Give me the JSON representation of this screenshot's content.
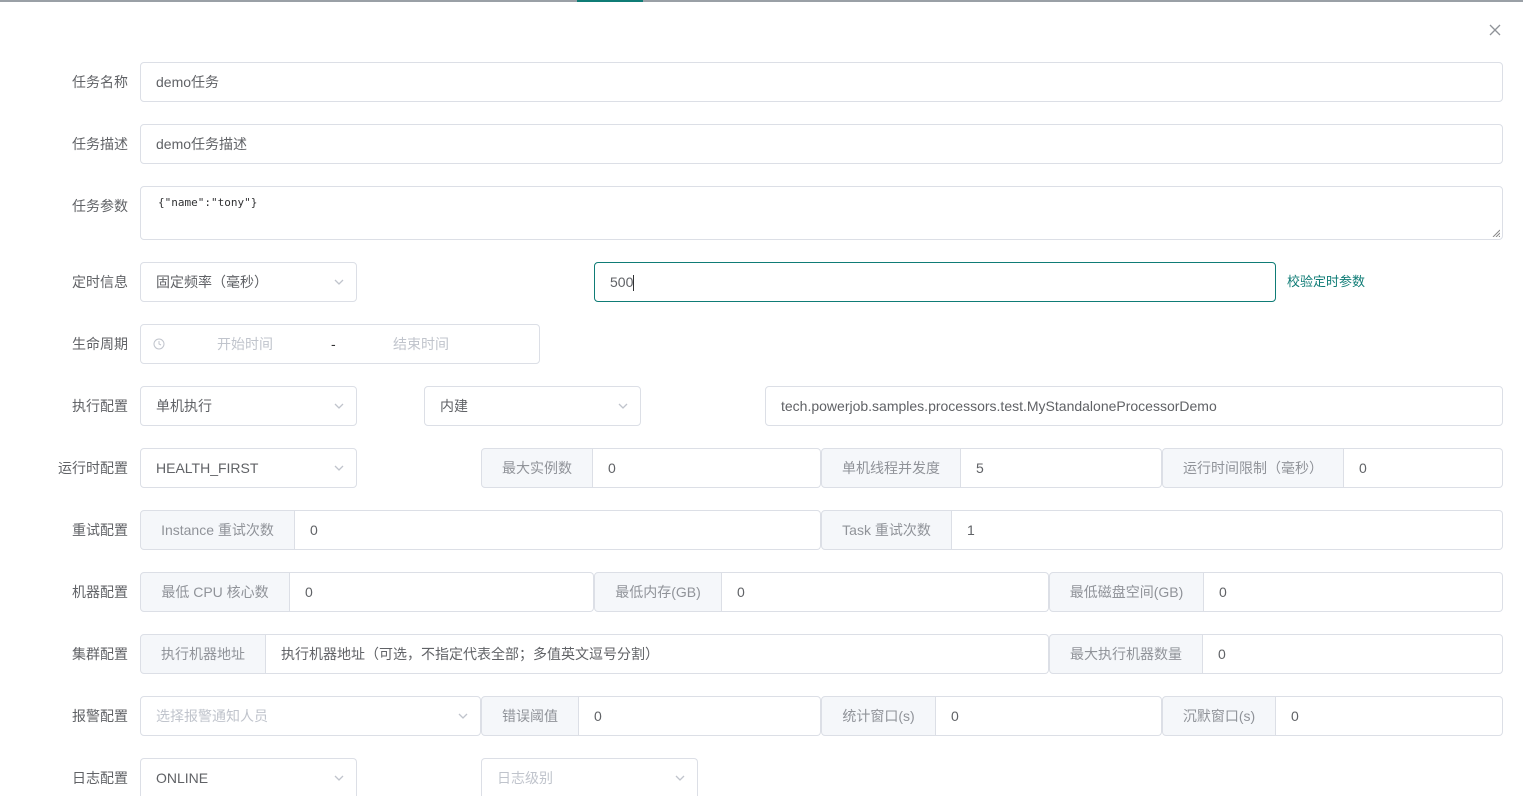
{
  "labels": {
    "task_name": "任务名称",
    "task_desc": "任务描述",
    "task_params": "任务参数",
    "timing": "定时信息",
    "lifecycle": "生命周期",
    "execution": "执行配置",
    "runtime": "运行时配置",
    "retry": "重试配置",
    "machine": "机器配置",
    "cluster": "集群配置",
    "alarm": "报警配置",
    "log": "日志配置"
  },
  "task_name": {
    "value": "demo任务"
  },
  "task_desc": {
    "value": "demo任务描述"
  },
  "task_params": {
    "value": "{\"name\":\"tony\"}"
  },
  "timing": {
    "type": "固定频率（毫秒）",
    "expression": "500",
    "validate_link": "校验定时参数"
  },
  "lifecycle": {
    "start_placeholder": "开始时间",
    "separator": "-",
    "end_placeholder": "结束时间"
  },
  "execution": {
    "mode": "单机执行",
    "processor_type": "内建",
    "processor_info": "tech.powerjob.samples.processors.test.MyStandaloneProcessorDemo"
  },
  "runtime": {
    "dispatch_strategy": "HEALTH_FIRST",
    "max_instances_label": "最大实例数",
    "max_instances": "0",
    "concurrency_label": "单机线程并发度",
    "concurrency": "5",
    "time_limit_label": "运行时间限制（毫秒）",
    "time_limit": "0"
  },
  "retry": {
    "instance_label": "Instance 重试次数",
    "instance_retry": "0",
    "task_label": "Task 重试次数",
    "task_retry": "1"
  },
  "machine": {
    "cpu_label": "最低 CPU 核心数",
    "cpu": "0",
    "memory_label": "最低内存(GB)",
    "memory": "0",
    "disk_label": "最低磁盘空间(GB)",
    "disk": "0"
  },
  "cluster": {
    "address_label": "执行机器地址",
    "address_placeholder": "执行机器地址（可选，不指定代表全部；多值英文逗号分割）",
    "max_workers_label": "最大执行机器数量",
    "max_workers": "0"
  },
  "alarm": {
    "receivers_placeholder": "选择报警通知人员",
    "error_threshold_label": "错误阈值",
    "error_threshold": "0",
    "stat_window_label": "统计窗口(s)",
    "stat_window": "0",
    "silence_window_label": "沉默窗口(s)",
    "silence_window": "0"
  },
  "log": {
    "type": "ONLINE",
    "level_placeholder": "日志级别"
  },
  "colors": {
    "accent": "#0f7c76",
    "border": "#dcdfe6",
    "prefix_bg": "#f5f7fa"
  },
  "icons": {
    "close": "close-icon",
    "select": "chevron-down-icon",
    "time": "clock-icon"
  }
}
